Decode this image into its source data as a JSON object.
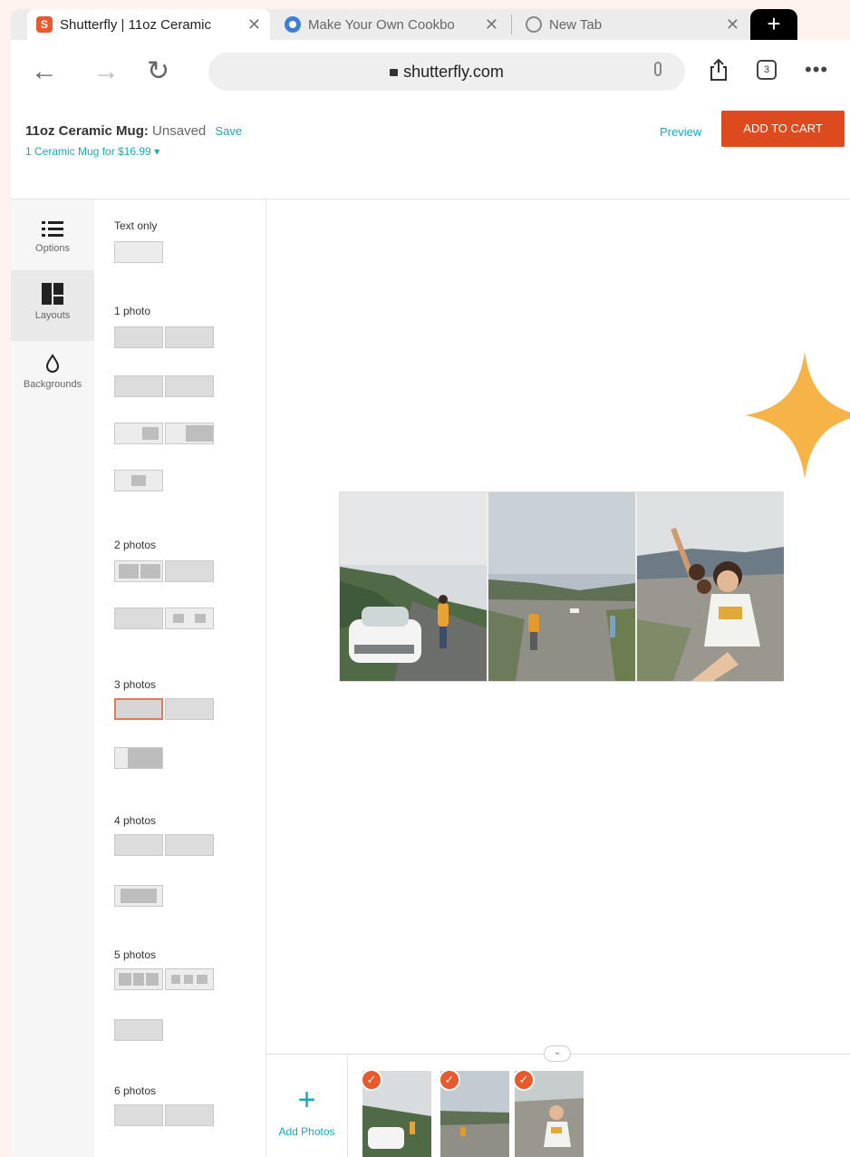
{
  "browser": {
    "tabs": [
      {
        "label": "Shutterfly | 11oz Ceramic",
        "favicon": "S",
        "active": true
      },
      {
        "label": "Make Your Own Cookbo",
        "active": false
      },
      {
        "label": "New Tab",
        "active": false
      }
    ],
    "url": "shutterfly.com",
    "tab_count": "3",
    "new_tab": "+",
    "close_glyph": "✕"
  },
  "header": {
    "product_name": "11oz Ceramic Mug:",
    "status": "Unsaved",
    "save_label": "Save",
    "price_line": "1 Ceramic Mug for $16.99 ▾",
    "preview_label": "Preview",
    "cart_label": "ADD TO CART"
  },
  "rail": [
    {
      "label": "Options",
      "icon": "list-icon"
    },
    {
      "label": "Layouts",
      "icon": "layout-grid-icon",
      "selected": true
    },
    {
      "label": "Backgrounds",
      "icon": "droplet-icon"
    }
  ],
  "layouts": {
    "sections": [
      "Text only",
      "1 photo",
      "2 photos",
      "3 photos",
      "4 photos",
      "5 photos",
      "6 photos"
    ],
    "selected_section": "3 photos"
  },
  "tray": {
    "add_label": "Add Photos",
    "photo_count": 3
  },
  "colors": {
    "accent": "#18aab8",
    "brand_orange": "#dd4a1e",
    "sparkle": "#f6b347"
  }
}
